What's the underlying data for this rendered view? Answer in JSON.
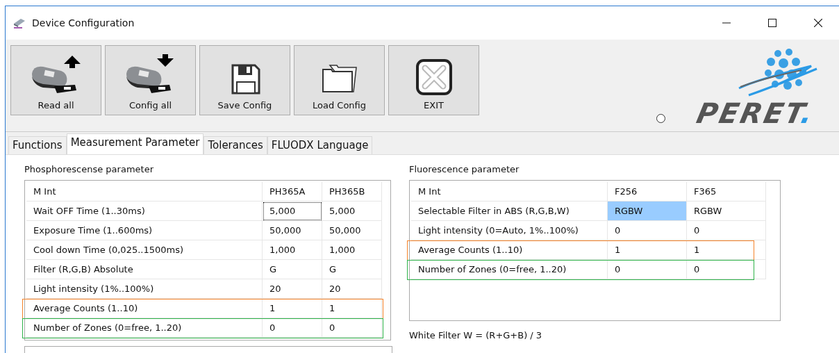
{
  "window": {
    "title": "Device Configuration"
  },
  "toolbar": [
    {
      "label": "Read all",
      "kind": "read"
    },
    {
      "label": "Config all",
      "kind": "config"
    },
    {
      "label": "Save Config",
      "kind": "save"
    },
    {
      "label": "Load Config",
      "kind": "load"
    },
    {
      "label": "EXIT",
      "kind": "exit"
    }
  ],
  "status_radio": {
    "checked": false
  },
  "logo": {
    "text": "PERET",
    "accent": "."
  },
  "tabs": [
    {
      "label": "Functions",
      "selected": false
    },
    {
      "label": "Measurement Parameter",
      "selected": true
    },
    {
      "label": "Tolerances",
      "selected": false
    },
    {
      "label": "FLUODX Language",
      "selected": false
    }
  ],
  "phosphorescence": {
    "title": "Phosphorescense parameter",
    "columns": [
      "M Int",
      "PH365A",
      "PH365B"
    ],
    "rows": [
      {
        "cells": [
          {
            "text": "Wait OFF Time (1..30ms)",
            "focused": false,
            "selected": false
          },
          {
            "text": "5,000",
            "focused": true,
            "selected": false
          },
          {
            "text": "5,000",
            "focused": false,
            "selected": false
          }
        ]
      },
      {
        "cells": [
          {
            "text": "Exposure Time (1..600ms)",
            "focused": false,
            "selected": false
          },
          {
            "text": "50,000",
            "focused": false,
            "selected": false
          },
          {
            "text": "50,000",
            "focused": false,
            "selected": false
          }
        ]
      },
      {
        "cells": [
          {
            "text": "Cool down Time (0,025..1500ms)",
            "focused": false,
            "selected": false
          },
          {
            "text": "1,000",
            "focused": false,
            "selected": false
          },
          {
            "text": "1,000",
            "focused": false,
            "selected": false
          }
        ]
      },
      {
        "cells": [
          {
            "text": "Filter (R,G,B) Absolute",
            "focused": false,
            "selected": false
          },
          {
            "text": "G",
            "focused": false,
            "selected": false
          },
          {
            "text": "G",
            "focused": false,
            "selected": false
          }
        ]
      },
      {
        "cells": [
          {
            "text": "Light intensity (1%..100%)",
            "focused": false,
            "selected": false
          },
          {
            "text": "20",
            "focused": false,
            "selected": false
          },
          {
            "text": "20",
            "focused": false,
            "selected": false
          }
        ]
      },
      {
        "color": "#f5832a",
        "cells": [
          {
            "text": "Average Counts (1..10)",
            "focused": false,
            "selected": false
          },
          {
            "text": "1",
            "focused": false,
            "selected": false
          },
          {
            "text": "1",
            "focused": false,
            "selected": false
          }
        ]
      },
      {
        "color": "#2fb34a",
        "cells": [
          {
            "text": "Number of Zones (0=free, 1..20)",
            "focused": false,
            "selected": false
          },
          {
            "text": "0",
            "focused": false,
            "selected": false
          },
          {
            "text": "0",
            "focused": false,
            "selected": false
          }
        ]
      }
    ]
  },
  "fluorescence": {
    "title": "Fluorescence parameter",
    "columns": [
      "M Int",
      "F256",
      "F365"
    ],
    "rows": [
      {
        "cells": [
          {
            "text": "Selectable Filter in ABS (R,G,B,W)",
            "focused": false,
            "selected": false
          },
          {
            "text": "RGBW",
            "focused": false,
            "selected": true
          },
          {
            "text": "RGBW",
            "focused": false,
            "selected": false
          }
        ]
      },
      {
        "cells": [
          {
            "text": "Light intensity (0=Auto, 1%..100%)",
            "focused": false,
            "selected": false
          },
          {
            "text": "0",
            "focused": false,
            "selected": false
          },
          {
            "text": "0",
            "focused": false,
            "selected": false
          }
        ]
      },
      {
        "color": "#f5832a",
        "cells": [
          {
            "text": "Average Counts (1..10)",
            "focused": false,
            "selected": false
          },
          {
            "text": "1",
            "focused": false,
            "selected": false
          },
          {
            "text": "1",
            "focused": false,
            "selected": false
          }
        ]
      },
      {
        "color": "#2fb34a",
        "cells": [
          {
            "text": "Number of Zones (0=free, 1..20)",
            "focused": false,
            "selected": false
          },
          {
            "text": "0",
            "focused": false,
            "selected": false
          },
          {
            "text": "0",
            "focused": false,
            "selected": false
          }
        ]
      }
    ],
    "note": "White Filter W = (R+G+B) / 3"
  }
}
